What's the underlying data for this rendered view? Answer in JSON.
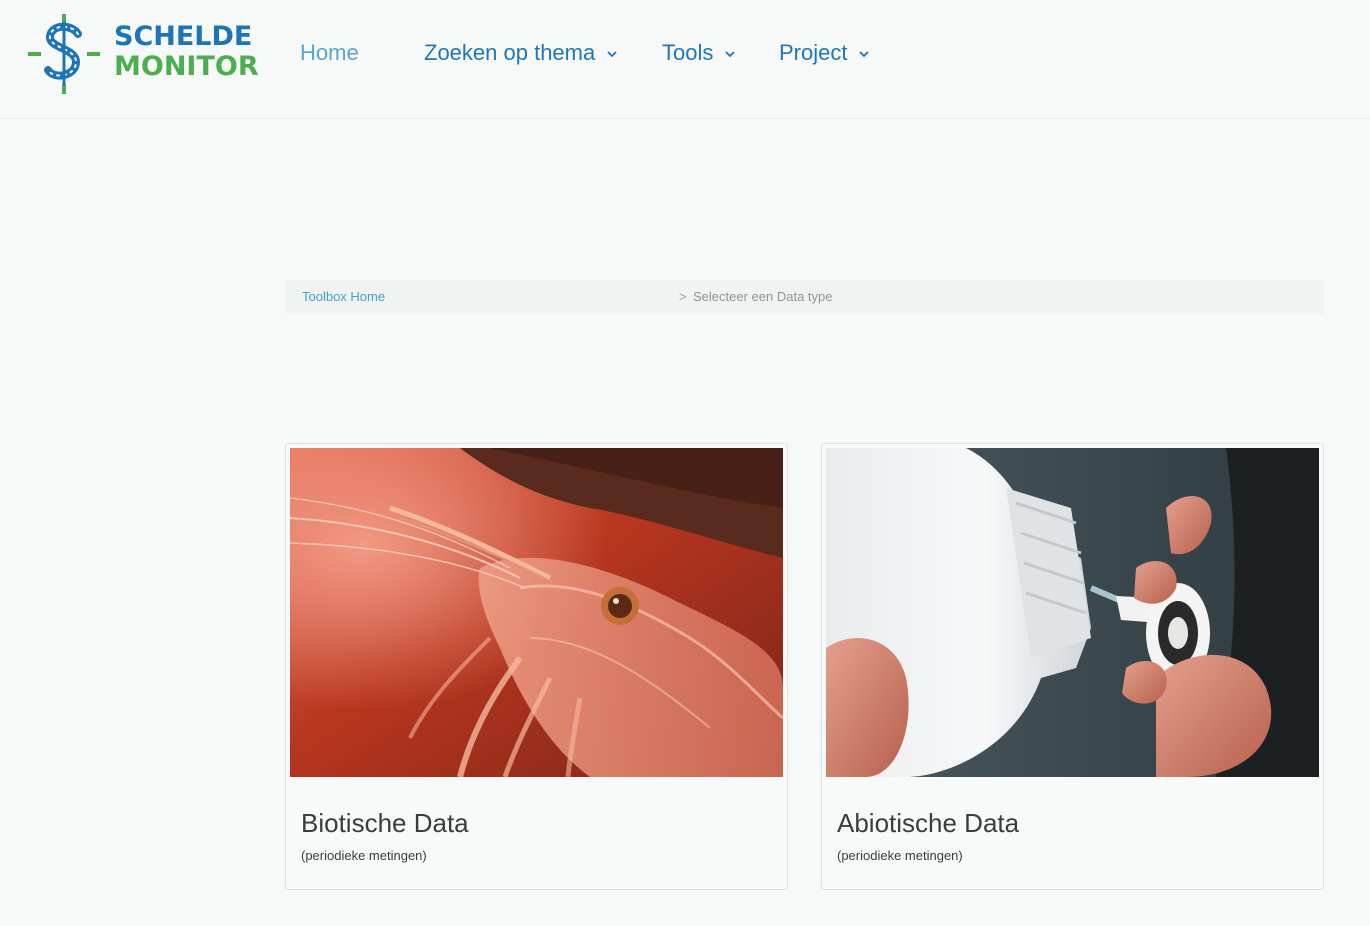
{
  "header": {
    "logo": {
      "line1": "SCHELDE",
      "line2": "MONITOR",
      "colors": {
        "blue": "#1d74b9",
        "green": "#4cae4f"
      }
    },
    "nav": [
      {
        "label": "Home",
        "active": true,
        "has_dropdown": false
      },
      {
        "label": "Zoeken op thema",
        "active": false,
        "has_dropdown": true
      },
      {
        "label": "Tools",
        "active": false,
        "has_dropdown": true
      },
      {
        "label": "Project",
        "active": false,
        "has_dropdown": true
      }
    ],
    "dropdown_icon": "chevron-down-icon"
  },
  "breadcrumb": {
    "home_label": "Toolbox Home",
    "separator": ">",
    "current": "Selecteer een Data type"
  },
  "cards": [
    {
      "title": "Biotische Data",
      "subtitle": "(periodieke metingen)",
      "image": "shrimp-photo"
    },
    {
      "title": "Abiotische Data",
      "subtitle": "(periodieke metingen)",
      "image": "sample-bottle-photo"
    }
  ],
  "colors": {
    "nav_link": "#1f77b4",
    "nav_active": "#5aa6cc",
    "breadcrumb_link": "#3fa1cc",
    "page_background": "#f7f8f8"
  }
}
